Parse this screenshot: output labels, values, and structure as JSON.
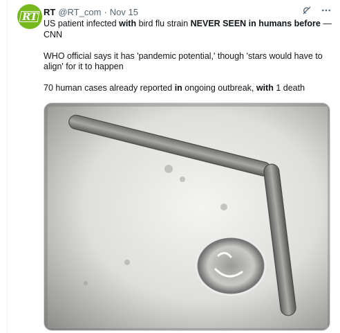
{
  "account": {
    "display_name": "RT",
    "handle": "@RT_com",
    "separator": "·",
    "time": "Nov 15",
    "avatar_text": "RT",
    "avatar_color": "#77b81c"
  },
  "header_icons": [
    "grok-icon",
    "more-icon"
  ],
  "tweet": {
    "line1_a": "US patient infected ",
    "line1_b": "with",
    "line1_c": " bird flu strain ",
    "line1_d": "NEVER SEEN in humans before",
    "line1_e": " —",
    "line2": "CNN",
    "para2": "WHO official says it has 'pandemic potential,' though 'stars would have to align' for it to happen",
    "para3_a": "70 human cases already reported ",
    "para3_b": "in",
    "para3_c": " ongoing outbreak, ",
    "para3_d": "with",
    "para3_e": " 1 death"
  },
  "media": {
    "description_icon": "virus-micrograph-image"
  }
}
